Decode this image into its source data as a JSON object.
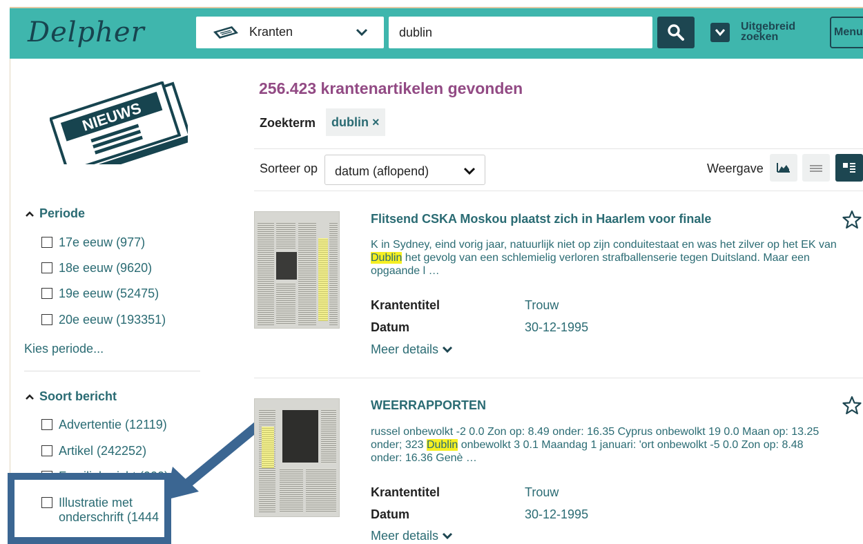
{
  "header": {
    "logo": "Delpher",
    "collection": "Kranten",
    "search_value": "dublin",
    "advanced_line1": "Uitgebreid",
    "advanced_line2": "zoeken",
    "menu": "Menu"
  },
  "sidebar": {
    "facets": [
      {
        "title": "Periode",
        "items": [
          "17e eeuw (977)",
          "18e eeuw (9620)",
          "19e eeuw (52475)",
          "20e eeuw (193351)"
        ]
      },
      {
        "title": "Soort bericht",
        "items": [
          "Advertentie (12119)",
          "Artikel (242252)",
          "Familiebericht (900)"
        ]
      }
    ],
    "kies_periode": "Kies periode...",
    "highlighted_item_line1": "Illustratie met",
    "highlighted_item_line2": "onderschrift (1444"
  },
  "results": {
    "count_text": "256.423 krantenartikelen gevonden",
    "term_label": "Zoekterm",
    "term_chip": "dublin ×",
    "sort_label": "Sorteer op",
    "sort_value": "datum (aflopend)",
    "view_label": "Weergave",
    "items": [
      {
        "title": "Flitsend CSKA Moskou plaatst zich in Haarlem voor finale",
        "snippet_before": "K in Sydney, eind vorig jaar, natuurlijk niet op zijn conduitestaat en was het zilver op het EK van ",
        "snippet_highlight": "Dublin",
        "snippet_after": " het gevolg van een schlemielig verloren strafballenserie tegen Duitsland. Maar een opgaande l …",
        "krantentitel_label": "Krantentitel",
        "krantentitel": "Trouw",
        "datum_label": "Datum",
        "datum": "30-12-1995",
        "meer": "Meer details"
      },
      {
        "title": "WEERRAPPORTEN",
        "snippet_before": "russel onbewolkt -2 0.0 Zon op: 8.49 onder: 16.35 Cyprus onbewolkt 19 0.0 Maan op: 13.25 onder; 323 ",
        "snippet_highlight": "Dublin",
        "snippet_after": " onbewolkt 3 0.1 Maandag 1 januari: 'ort onbewolkt -5 0.0 Zon op: 8.48 onder: 16.36 Genè …",
        "krantentitel_label": "Krantentitel",
        "krantentitel": "Trouw",
        "datum_label": "Datum",
        "datum": "30-12-1995",
        "meer": "Meer details"
      }
    ]
  },
  "colors": {
    "header_bg": "#3fb6ad",
    "dark_teal": "#1d4651",
    "link_teal": "#2a6b73",
    "count_purple": "#924a84",
    "highlight_yellow": "#f5ef22",
    "annotation_blue": "#3b6692"
  },
  "icons": [
    "newspaper-icon",
    "chevron-down-icon",
    "search-icon",
    "caret-up-icon",
    "star-icon",
    "chart-view-icon",
    "list-view-icon",
    "detail-view-icon",
    "news-illustration-icon",
    "annotation-arrow"
  ]
}
